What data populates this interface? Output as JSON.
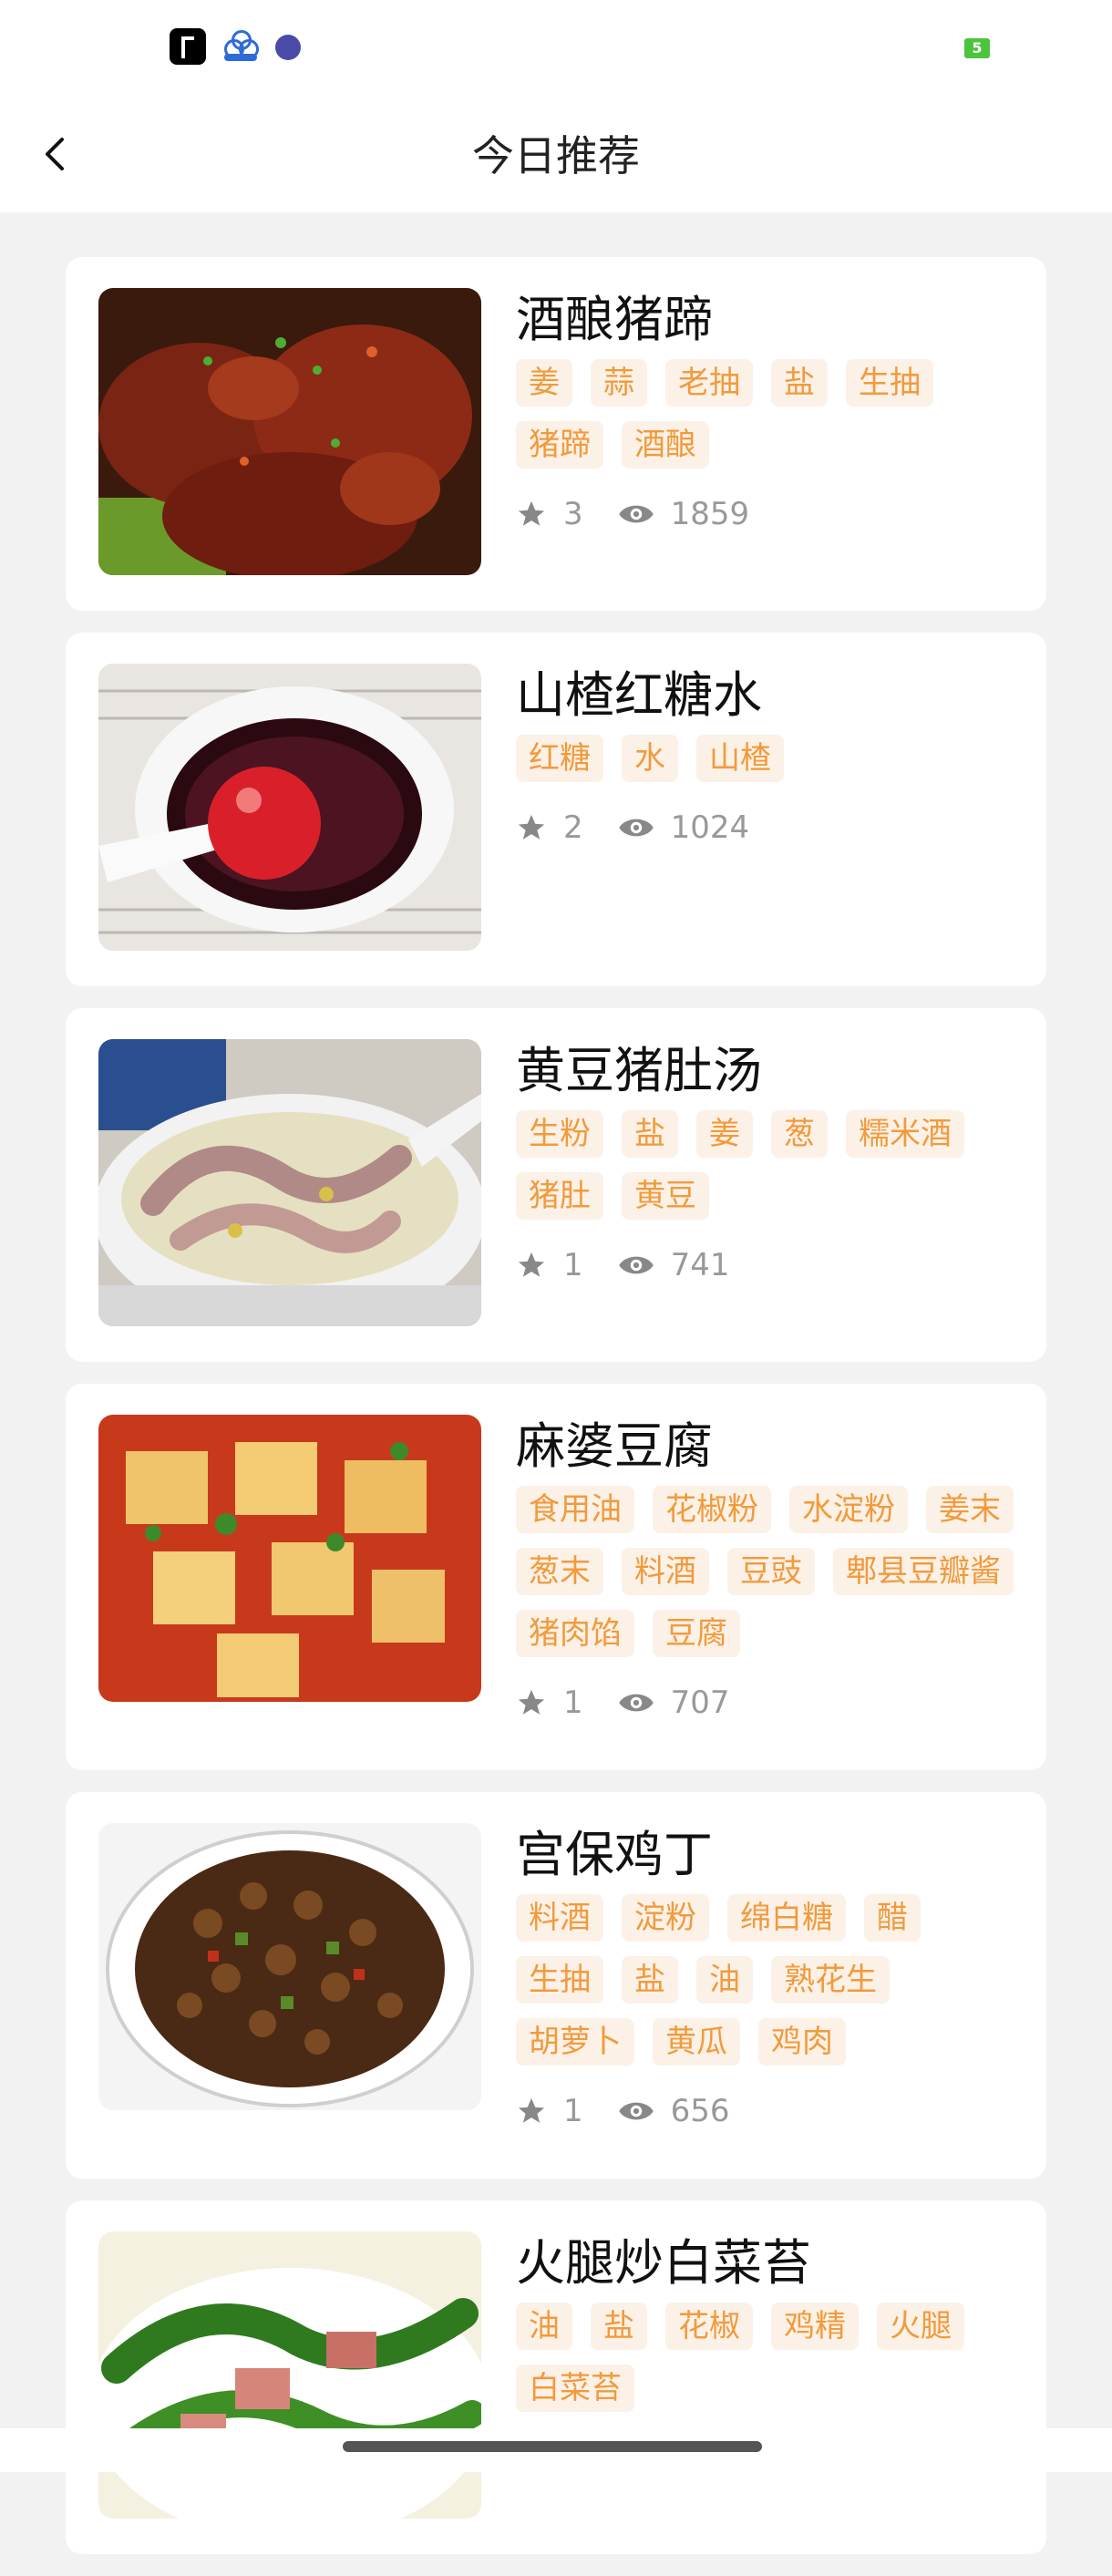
{
  "status_bar": {
    "battery": "5"
  },
  "header": {
    "title": "今日推荐"
  },
  "recipes": [
    {
      "name": "酒酿猪蹄",
      "tags": [
        "姜",
        "蒜",
        "老抽",
        "盐",
        "生抽",
        "猪蹄",
        "酒酿"
      ],
      "stars": "3",
      "views": "1859"
    },
    {
      "name": "山楂红糖水",
      "tags": [
        "红糖",
        "水",
        "山楂"
      ],
      "stars": "2",
      "views": "1024"
    },
    {
      "name": "黄豆猪肚汤",
      "tags": [
        "生粉",
        "盐",
        "姜",
        "葱",
        "糯米酒",
        "猪肚",
        "黄豆"
      ],
      "stars": "1",
      "views": "741"
    },
    {
      "name": "麻婆豆腐",
      "tags": [
        "食用油",
        "花椒粉",
        "水淀粉",
        "姜末",
        "葱末",
        "料酒",
        "豆豉",
        "郫县豆瓣酱",
        "猪肉馅",
        "豆腐"
      ],
      "stars": "1",
      "views": "707"
    },
    {
      "name": "宫保鸡丁",
      "tags": [
        "料酒",
        "淀粉",
        "绵白糖",
        "醋",
        "生抽",
        "盐",
        "油",
        "熟花生",
        "胡萝卜",
        "黄瓜",
        "鸡肉"
      ],
      "stars": "1",
      "views": "656"
    },
    {
      "name": "火腿炒白菜苔",
      "tags": [
        "油",
        "盐",
        "花椒",
        "鸡精",
        "火腿",
        "白菜苔"
      ],
      "stars": "",
      "views": ""
    }
  ],
  "colors": {
    "tag_bg": "#fbf1e6",
    "tag_text": "#f29a3c",
    "meta": "#999999"
  }
}
